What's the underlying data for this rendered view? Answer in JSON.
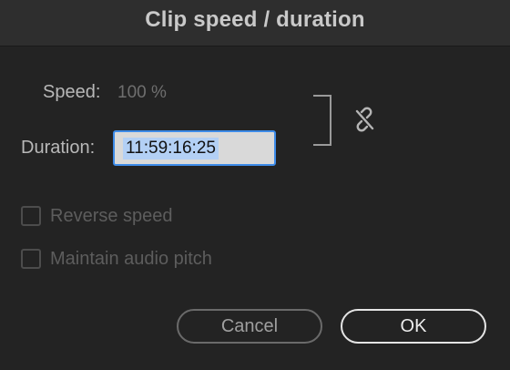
{
  "dialog": {
    "title": "Clip speed / duration"
  },
  "speed": {
    "label": "Speed:",
    "value": "100 %"
  },
  "duration": {
    "label": "Duration:",
    "value": "11:59:16:25"
  },
  "link": {
    "icon": "unlinked-chain-icon",
    "state": "unlinked"
  },
  "options": {
    "reverse_speed": {
      "label": "Reverse speed",
      "checked": false,
      "enabled": false
    },
    "maintain_pitch": {
      "label": "Maintain audio pitch",
      "checked": false,
      "enabled": false
    }
  },
  "buttons": {
    "cancel": "Cancel",
    "ok": "OK"
  },
  "colors": {
    "background": "#232323",
    "titlebar": "#2e2e2e",
    "focus_ring": "#3d8be8",
    "selection": "#b3d0f5"
  }
}
